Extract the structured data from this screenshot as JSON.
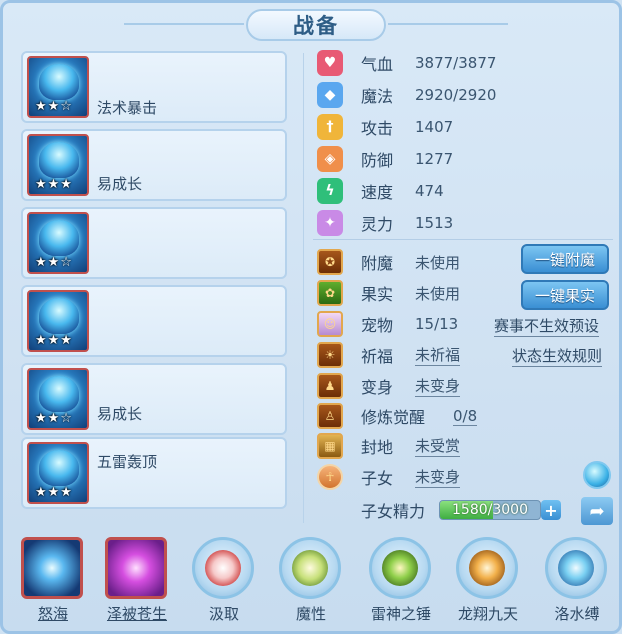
{
  "title": "战备",
  "skills": [
    {
      "name": "法术暴击",
      "stars": "★★☆"
    },
    {
      "name": "易成长",
      "stars": "★★★"
    },
    {
      "name": "",
      "stars": "★★☆"
    },
    {
      "name": "",
      "stars": "★★★"
    },
    {
      "name": "易成长",
      "stars": "★★☆"
    },
    {
      "name": "五雷轰顶",
      "stars": "★★★"
    }
  ],
  "attributes": [
    {
      "label": "气血",
      "value": "3877/3877",
      "icon": "heart-icon",
      "color": "#e85a74"
    },
    {
      "label": "魔法",
      "value": "2920/2920",
      "icon": "mana-icon",
      "color": "#5aa7ef"
    },
    {
      "label": "攻击",
      "value": "1407",
      "icon": "sword-icon",
      "color": "#f0b53a"
    },
    {
      "label": "防御",
      "value": "1277",
      "icon": "shield-icon",
      "color": "#f08f4a"
    },
    {
      "label": "速度",
      "value": "474",
      "icon": "lightning-icon",
      "color": "#2fbf7a"
    },
    {
      "label": "灵力",
      "value": "1513",
      "icon": "spirit-icon",
      "color": "#c98ae6"
    }
  ],
  "features": [
    {
      "label": "附魔",
      "value": "未使用"
    },
    {
      "label": "果实",
      "value": "未使用"
    },
    {
      "label": "宠物",
      "value": "15/13"
    },
    {
      "label": "祈福",
      "value": "未祈福"
    },
    {
      "label": "变身",
      "value": "未变身"
    },
    {
      "label": "修炼觉醒",
      "value": "0/8"
    },
    {
      "label": "封地",
      "value": "未受赏"
    },
    {
      "label": "子女",
      "value": "未变身"
    }
  ],
  "buttons": {
    "enchant": "一键附魔",
    "fruit": "一键果实",
    "event_link": "赛事不生效预设",
    "rule_link": "状态生效规则"
  },
  "essence": {
    "label": "子女精力",
    "value": "1580/3000",
    "fraction": 0.527,
    "plus": "+"
  },
  "bottom": [
    {
      "label": "怒海"
    },
    {
      "label": "泽被苍生"
    },
    {
      "label": "汲取"
    },
    {
      "label": "魔性"
    },
    {
      "label": "雷神之锤"
    },
    {
      "label": "龙翔九天"
    },
    {
      "label": "洛水缚"
    }
  ],
  "colors": {
    "accent": "#3a8fd3",
    "text": "#2f4a66",
    "border_red": "#c0504d"
  }
}
